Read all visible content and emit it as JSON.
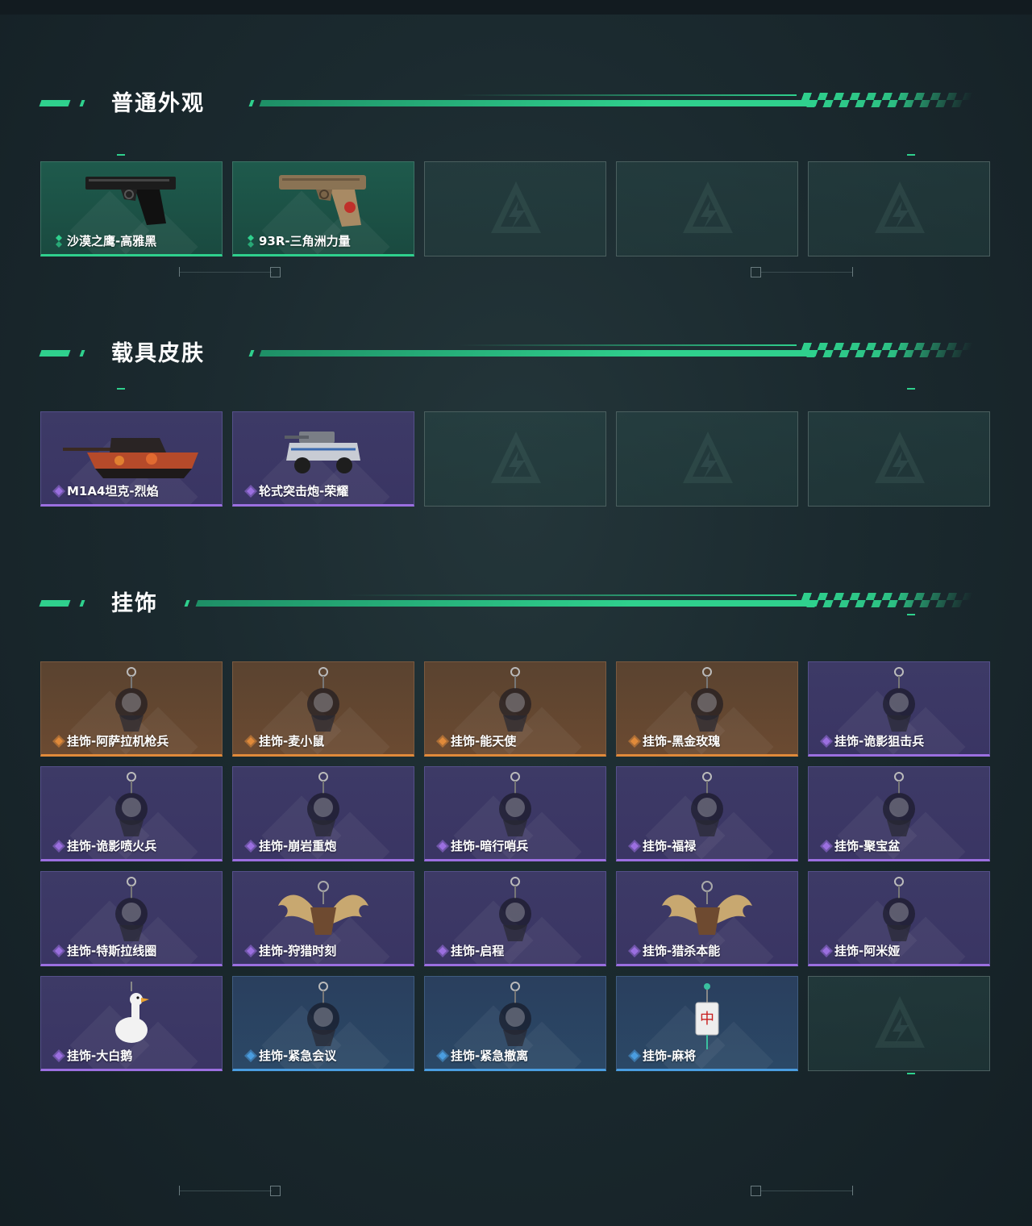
{
  "sections": [
    {
      "title": "普通外观",
      "cards": [
        {
          "label": "沙漠之鹰-高雅黑",
          "rarity": "green",
          "item": "pistol-black"
        },
        {
          "label": "93R-三角洲力量",
          "rarity": "green",
          "item": "pistol-tan"
        },
        {
          "label": "",
          "rarity": "empty",
          "item": "empty"
        },
        {
          "label": "",
          "rarity": "empty",
          "item": "empty"
        },
        {
          "label": "",
          "rarity": "empty",
          "item": "empty"
        }
      ]
    },
    {
      "title": "载具皮肤",
      "cards": [
        {
          "label": "M1A4坦克-烈焰",
          "rarity": "purple",
          "item": "tank"
        },
        {
          "label": "轮式突击炮-荣耀",
          "rarity": "purple",
          "item": "armored-car"
        },
        {
          "label": "",
          "rarity": "empty",
          "item": "empty"
        },
        {
          "label": "",
          "rarity": "empty",
          "item": "empty"
        },
        {
          "label": "",
          "rarity": "empty",
          "item": "empty"
        }
      ]
    },
    {
      "title": "挂饰",
      "cards": [
        {
          "label": "挂饰-阿萨拉机枪兵",
          "rarity": "orange",
          "item": "charm"
        },
        {
          "label": "挂饰-麦小鼠",
          "rarity": "orange",
          "item": "charm"
        },
        {
          "label": "挂饰-能天使",
          "rarity": "orange",
          "item": "charm"
        },
        {
          "label": "挂饰-黑金玫瑰",
          "rarity": "orange",
          "item": "charm"
        },
        {
          "label": "挂饰-诡影狙击兵",
          "rarity": "purple",
          "item": "charm"
        },
        {
          "label": "挂饰-诡影喷火兵",
          "rarity": "purple",
          "item": "charm"
        },
        {
          "label": "挂饰-崩岩重炮",
          "rarity": "purple",
          "item": "charm"
        },
        {
          "label": "挂饰-暗行哨兵",
          "rarity": "purple",
          "item": "charm"
        },
        {
          "label": "挂饰-福禄",
          "rarity": "purple",
          "item": "charm"
        },
        {
          "label": "挂饰-聚宝盆",
          "rarity": "purple",
          "item": "charm"
        },
        {
          "label": "挂饰-特斯拉线圈",
          "rarity": "purple",
          "item": "charm"
        },
        {
          "label": "挂饰-狩猎时刻",
          "rarity": "purple",
          "item": "antlers"
        },
        {
          "label": "挂饰-启程",
          "rarity": "purple",
          "item": "charm"
        },
        {
          "label": "挂饰-猎杀本能",
          "rarity": "purple",
          "item": "antlers"
        },
        {
          "label": "挂饰-阿米娅",
          "rarity": "purple",
          "item": "charm"
        },
        {
          "label": "挂饰-大白鹅",
          "rarity": "purple",
          "item": "goose"
        },
        {
          "label": "挂饰-紧急会议",
          "rarity": "blue",
          "item": "charm"
        },
        {
          "label": "挂饰-紧急撤离",
          "rarity": "blue",
          "item": "charm"
        },
        {
          "label": "挂饰-麻将",
          "rarity": "blue",
          "item": "mahjong"
        },
        {
          "label": "",
          "rarity": "empty",
          "item": "empty"
        }
      ]
    }
  ],
  "colors": {
    "accent": "#2fd08d",
    "green": "#2fd08d",
    "purple": "#9b6fe0",
    "orange": "#e08a3a",
    "blue": "#4a9de0"
  }
}
